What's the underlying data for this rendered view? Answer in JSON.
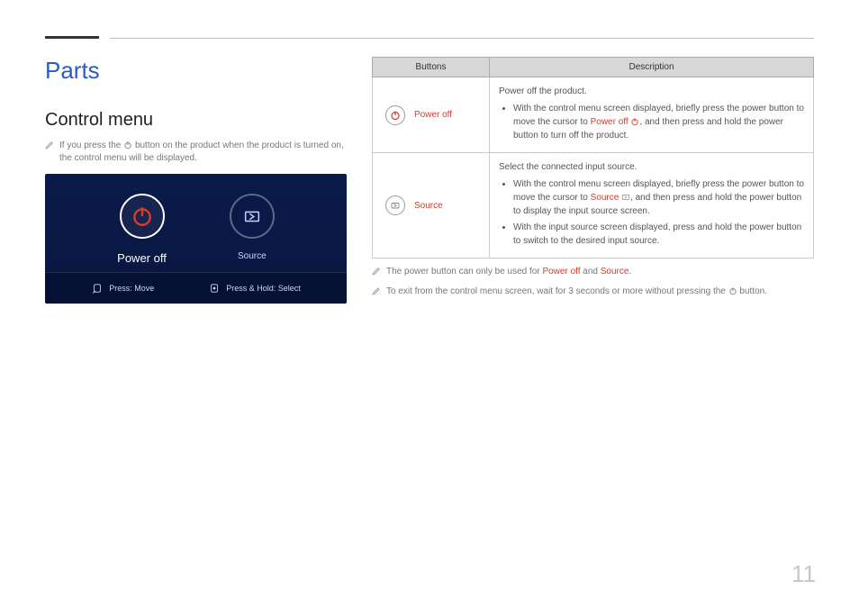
{
  "chapter_title": "Parts",
  "section_title": "Control menu",
  "intro_note_pre": "If you press the ",
  "intro_note_post": " button on the product when the product is turned on, the control menu will be displayed.",
  "control_menu": {
    "items": [
      {
        "label": "Power off",
        "style": "big"
      },
      {
        "label": "Source",
        "style": "small"
      }
    ],
    "hints": [
      {
        "label": "Press: Move"
      },
      {
        "label": "Press & Hold: Select"
      }
    ]
  },
  "table": {
    "headers": {
      "buttons": "Buttons",
      "description": "Description"
    },
    "rows": [
      {
        "button_label": "Power off",
        "desc_lead": "Power off the product.",
        "bullet1_pre": "With the control menu screen displayed, briefly press the power button to move the cursor to ",
        "bullet1_highlight": "Power off",
        "bullet1_post": ", and then press and hold the power button to turn off the product."
      },
      {
        "button_label": "Source",
        "desc_lead": "Select the connected input source.",
        "bullet1_pre": "With the control menu screen displayed, briefly press the power button to move the cursor to ",
        "bullet1_highlight": "Source",
        "bullet1_post": ", and then press and hold the power button to display the input source screen.",
        "bullet2": "With the input source screen displayed, press and hold the power button to switch to the desired input source."
      }
    ]
  },
  "footnotes": {
    "f1_pre": "The power button can only be used for ",
    "f1_h1": "Power off",
    "f1_mid": " and ",
    "f1_h2": "Source",
    "f1_post": ".",
    "f2_pre": "To exit from the control menu screen, wait for 3 seconds or more without pressing the ",
    "f2_post": " button."
  },
  "page_number": "11"
}
